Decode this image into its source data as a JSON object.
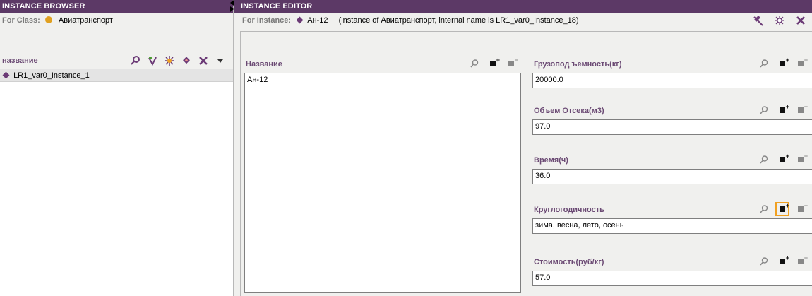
{
  "left": {
    "title": "INSTANCE BROWSER",
    "for_class_label": "For Class:",
    "for_class_value": "Авиатранспорт",
    "column_header": "название",
    "items": [
      {
        "label": "LR1_var0_Instance_1"
      }
    ]
  },
  "right": {
    "title": "INSTANCE EDITOR",
    "for_instance_label": "For Instance:",
    "for_instance_value": "Ан-12",
    "instance_desc": "(instance of Авиатранспорт, internal name is LR1_var0_Instance_18)",
    "fields": {
      "name": {
        "label": "Название",
        "value": "Ан-12"
      },
      "capacity": {
        "label": "Грузопод ъемность(кг)",
        "value": "20000.0"
      },
      "volume": {
        "label": "Объем Отсека(м3)",
        "value": "97.0"
      },
      "time": {
        "label": "Время(ч)",
        "value": "36.0"
      },
      "year_round": {
        "label": "Круглогодичность",
        "value": "зима, весна, лето, осень"
      },
      "cost": {
        "label": "Стоимость(руб/кг)",
        "value": "57.0"
      }
    }
  },
  "colors": {
    "titlebar": "#5c3966",
    "label": "#6b4a74",
    "class_dot": "#e0a020",
    "highlight": "#f0a020"
  },
  "icons": {
    "left_toolbar": [
      "search-icon",
      "reference-icon",
      "create-icon",
      "copy-icon",
      "delete-icon",
      "menu-icon"
    ],
    "right_toolbar": [
      "hide-icon",
      "clear-icon",
      "close-icon"
    ],
    "field_toolbar": [
      "search-icon",
      "add-icon",
      "remove-icon"
    ]
  }
}
